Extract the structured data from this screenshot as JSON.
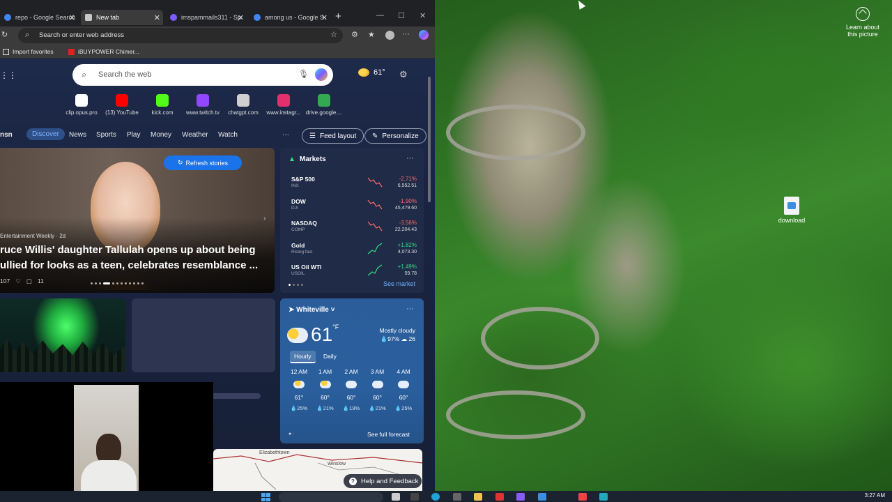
{
  "desktop": {
    "learn_about": "Learn about this picture",
    "icon_label": "download",
    "clock": "3:27 AM"
  },
  "browser": {
    "tabs": [
      {
        "label": "repo - Google Search",
        "color": "#4285f4"
      },
      {
        "label": "New tab",
        "color": "#c8c8c8"
      },
      {
        "label": "imspammails311 - Sp",
        "color": "#7c5cff"
      },
      {
        "label": "among us - Google S",
        "color": "#4285f4"
      }
    ],
    "address_placeholder": "Search or enter web address",
    "favorites": [
      {
        "label": "Import favorites",
        "icon": "import-icon"
      },
      {
        "label": "iBUYPOWER Chimer...",
        "icon": "ibuypower-icon"
      }
    ]
  },
  "newtab": {
    "search_placeholder": "Search the web",
    "weather_mini": "61°",
    "quick_links": [
      {
        "label": "clip.opus.pro",
        "color": "#ffffff"
      },
      {
        "label": "(13) YouTube",
        "color": "#ff0000"
      },
      {
        "label": "kick.com",
        "color": "#53fc18"
      },
      {
        "label": "www.twitch.tv",
        "color": "#9146ff"
      },
      {
        "label": "chatgpt.com",
        "color": "#cfcfcf"
      },
      {
        "label": "www.instagr...",
        "color": "#e1306c"
      },
      {
        "label": "drive.google....",
        "color": "#34a853"
      }
    ],
    "brand": "nsn",
    "nav": [
      "Discover",
      "News",
      "Sports",
      "Play",
      "Money",
      "Weather",
      "Watch"
    ],
    "more": "···",
    "feed_layout": "Feed layout",
    "personalize": "Personalize"
  },
  "hero": {
    "refresh": "Refresh stories",
    "source": "Entertainment Weekly · 2d",
    "title_line1": "ruce Willis' daughter Tallulah opens up about being",
    "title_line2": "ullied for looks as a teen, celebrates resemblance ...",
    "likes": "107",
    "comments": "11"
  },
  "markets": {
    "title": "Markets",
    "more": "···",
    "rows": [
      {
        "name": "S&P 500",
        "sub": "INX",
        "pct": "-2.71%",
        "val": "6,552.51",
        "up": false
      },
      {
        "name": "DOW",
        "sub": "DJI",
        "pct": "-1.90%",
        "val": "45,479.60",
        "up": false
      },
      {
        "name": "NASDAQ",
        "sub": "COMP",
        "pct": "-3.56%",
        "val": "22,204.43",
        "up": false
      },
      {
        "name": "Gold",
        "sub": "Rising fast",
        "pct": "+1.82%",
        "val": "4,073.30",
        "up": true
      },
      {
        "name": "US Oil WTI",
        "sub": "USOIL",
        "pct": "+1.49%",
        "val": "59.78",
        "up": true
      }
    ],
    "see_market": "See market",
    "down_color": "#ff6b6b",
    "up_color": "#3ddc84"
  },
  "weather": {
    "location": "Whiteville",
    "more": "···",
    "temp": "61",
    "unit": "°F",
    "condition": "Mostly cloudy",
    "details": "💧97%   ☁ 26",
    "tab_hourly": "Hourly",
    "tab_daily": "Daily",
    "hours": [
      {
        "time": "12 AM",
        "temp": "61°",
        "precip": "💧25%",
        "icon": "partly-cloudy"
      },
      {
        "time": "1 AM",
        "temp": "60°",
        "precip": "💧21%",
        "icon": "partly-cloudy"
      },
      {
        "time": "2 AM",
        "temp": "60°",
        "precip": "💧19%",
        "icon": "cloudy"
      },
      {
        "time": "3 AM",
        "temp": "60°",
        "precip": "💧21%",
        "icon": "cloudy"
      },
      {
        "time": "4 AM",
        "temp": "60°",
        "precip": "💧25%",
        "icon": "cloudy"
      }
    ],
    "full_forecast": "See full forecast"
  },
  "map": {
    "label1": "Elizabethtown",
    "label2": "Winslow"
  },
  "help": "Help and Feedback"
}
